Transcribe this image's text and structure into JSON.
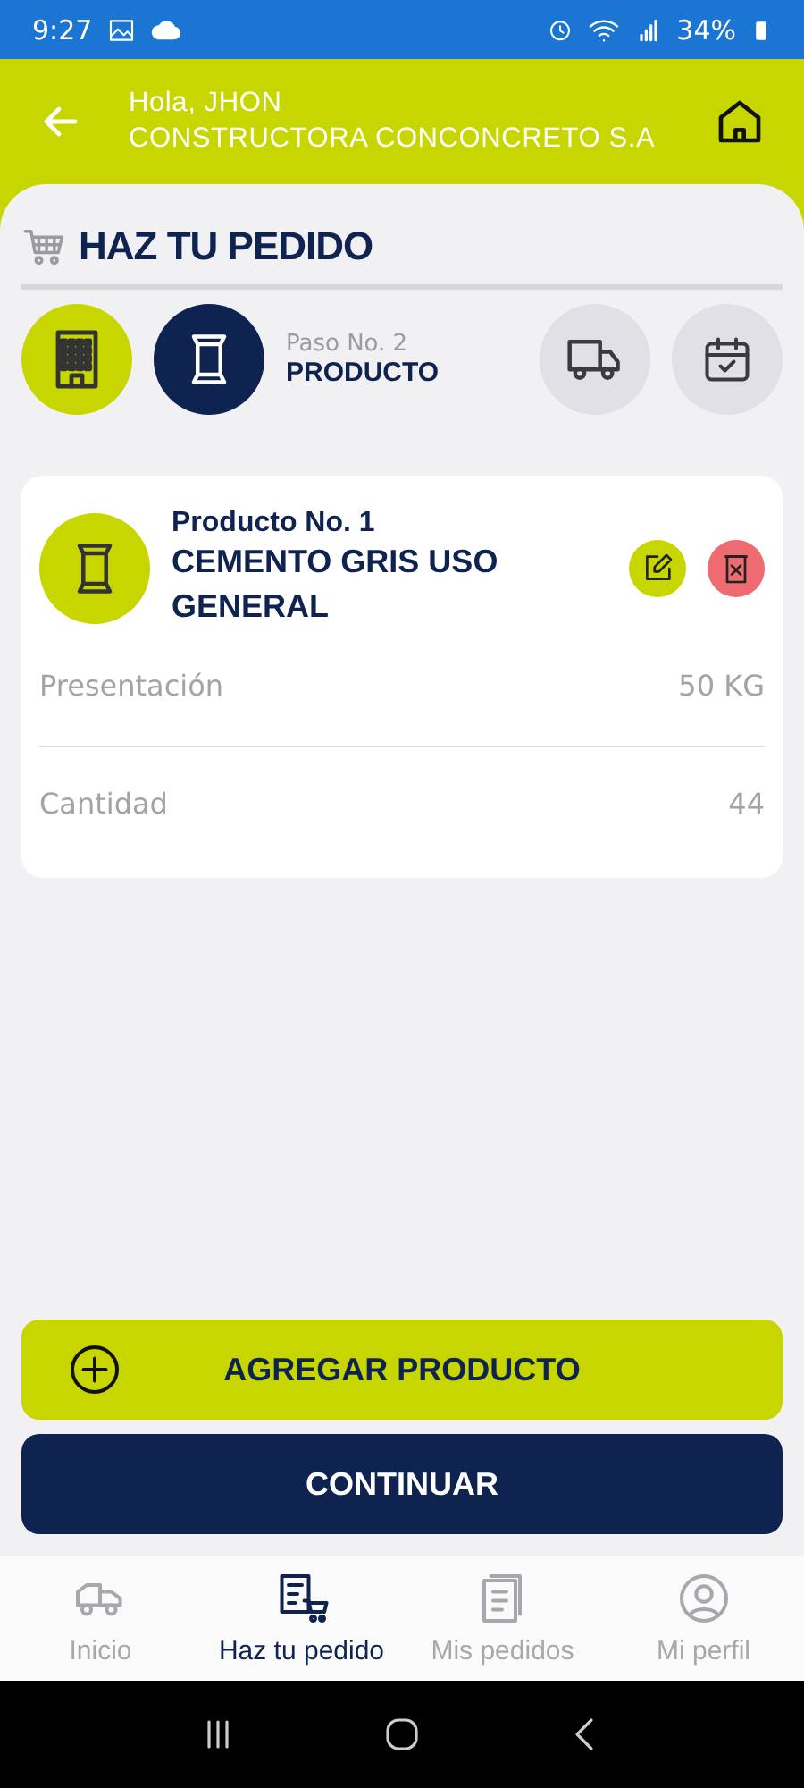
{
  "status_bar": {
    "time": "9:27",
    "battery": "34%"
  },
  "header": {
    "greeting": "Hola, JHON",
    "company": "CONSTRUCTORA CONCONCRETO S.A"
  },
  "title": "HAZ TU PEDIDO",
  "steps": [
    {
      "kind": "building",
      "completed": true,
      "selected": false
    },
    {
      "kind": "bag",
      "completed": false,
      "selected": true,
      "caption": "Paso No. 2",
      "label": "PRODUCTO"
    },
    {
      "kind": "truck",
      "completed": false,
      "selected": false
    },
    {
      "kind": "calendar",
      "completed": false,
      "selected": false
    }
  ],
  "products": [
    {
      "heading": "Producto No. 1",
      "name": "CEMENTO GRIS USO GENERAL",
      "fields": [
        {
          "label": "Presentación",
          "value": "50 KG"
        },
        {
          "label": "Cantidad",
          "value": "44"
        }
      ]
    }
  ],
  "add_button": "AGREGAR PRODUCTO",
  "continue_button": "CONTINUAR",
  "nav": [
    {
      "kind": "mixer",
      "label": "Inicio",
      "selected": false
    },
    {
      "kind": "order",
      "label": "Haz tu pedido",
      "selected": true
    },
    {
      "kind": "orders",
      "label": "Mis pedidos",
      "selected": false
    },
    {
      "kind": "profile",
      "label": "Mi perfil",
      "selected": false
    }
  ]
}
